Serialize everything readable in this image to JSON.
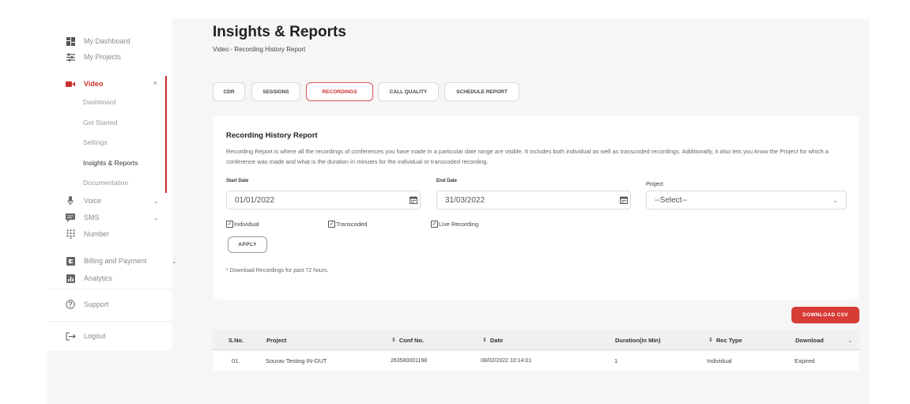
{
  "sidebar": {
    "top_items": [
      {
        "label": "My Dashboard",
        "icon": "dashboard-icon"
      },
      {
        "label": "My Projects",
        "icon": "projects-icon"
      }
    ],
    "video": {
      "label": "Video",
      "icon": "video-camera-icon",
      "chevron": "^"
    },
    "video_sub": [
      "Dashboard",
      "Get Started",
      "Settings",
      "Insights & Reports",
      "Documentation"
    ],
    "voice": {
      "label": "Voice",
      "chevron": "⌄"
    },
    "sms": {
      "label": "SMS",
      "chevron": "⌄"
    },
    "number": {
      "label": "Number"
    },
    "billing": {
      "label": "Billing and Payment",
      "chevron": "⌄"
    },
    "analytics": {
      "label": "Analytics"
    },
    "support": {
      "label": "Support"
    },
    "logout": {
      "label": "Logout"
    }
  },
  "header": {
    "title": "Insights & Reports",
    "subtitle": "Video - Recording History Report"
  },
  "tabs": [
    "CDR",
    "SESSIONS",
    "RECORDINGS",
    "CALL QUALITY",
    "SCHEDULE REPORT"
  ],
  "report": {
    "title": "Recording History Report",
    "description": "Recording Report is where all the recordings of conferences you have made in a particular date range are visible. It includes both individual as well as transcoded recordings. Additionally, it also lets you know the Project for which a conference was made and what is the duration in minutes for the individual or transcoded recording.",
    "start_label": "Start Date",
    "start_value": "01/01/2022",
    "end_label": "End Date",
    "end_value": "31/03/2022",
    "project_label": "Project",
    "project_value": "--Select--",
    "checkboxes": [
      "Individual",
      "Transcoded",
      "Live Recording"
    ],
    "apply_label": "APPLY",
    "note": "* Download Recordings for past 72 hours."
  },
  "download_csv_label": "DOWNLOAD CSV",
  "table": {
    "headers": [
      "S.No.",
      "Project",
      "Conf No.",
      "Date",
      "Duration(in Min)",
      "Rec Type",
      "Download"
    ],
    "rows": [
      [
        "01.",
        "Sourav Testing IN-OUT",
        "263580001198",
        "08/02/2022 10:14:01",
        "1",
        "Individual",
        "Expired"
      ]
    ]
  },
  "colors": {
    "accent": "#c9302c",
    "button": "#d73b36",
    "background": "#f6f6f6"
  }
}
